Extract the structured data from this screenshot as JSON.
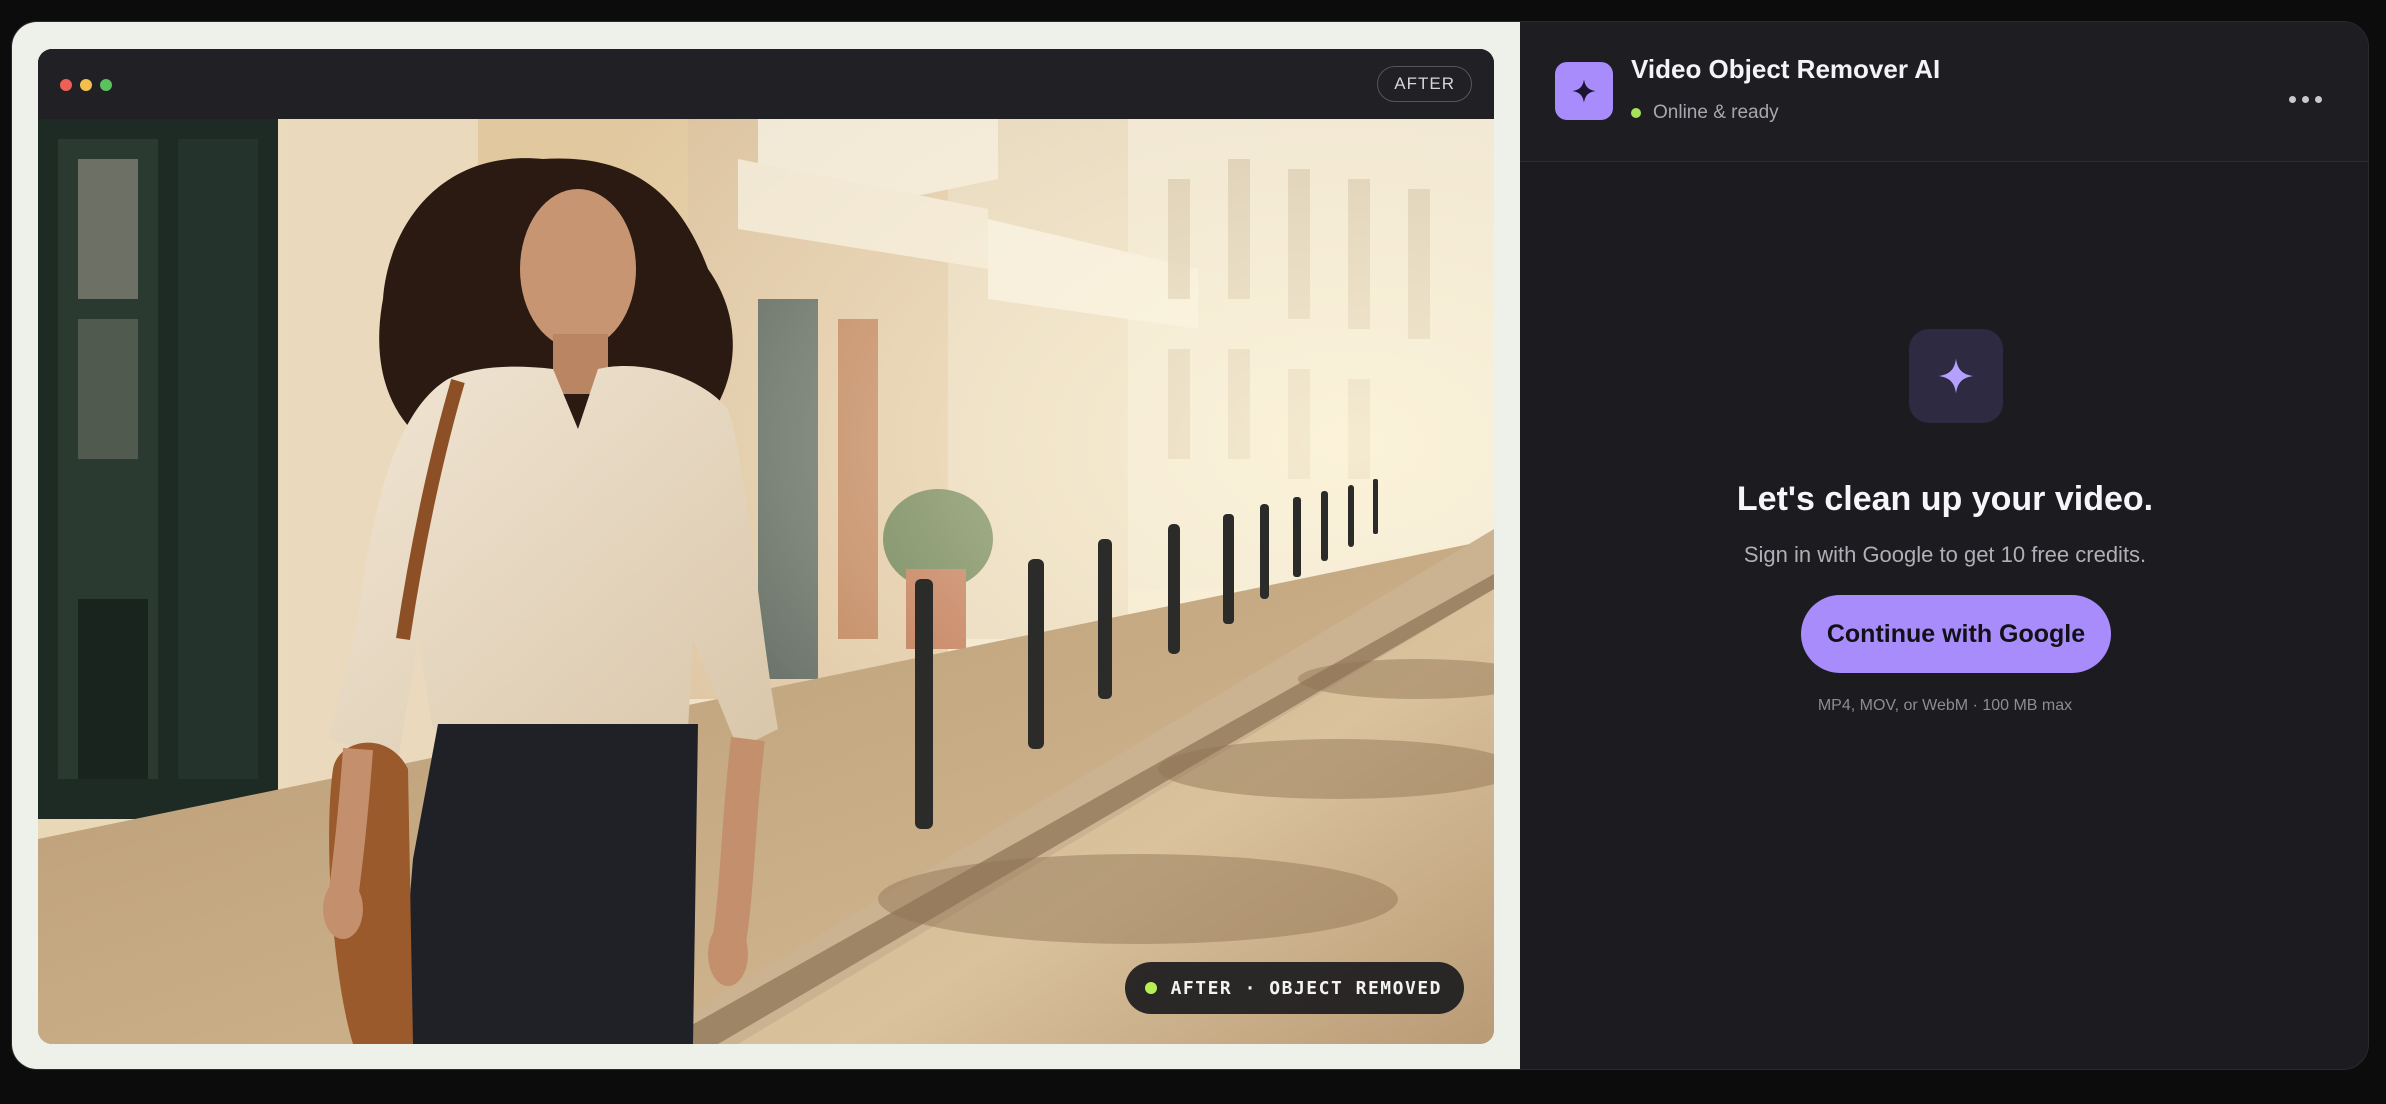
{
  "preview": {
    "window_badge": "AFTER",
    "status_chip": "AFTER · OBJECT REMOVED"
  },
  "panel": {
    "app_title": "Video Object Remover AI",
    "status": "Online & ready",
    "headline": "Let's clean up your video.",
    "subtitle": "Sign in with Google to get 10 free credits.",
    "cta_label": "Continue with Google",
    "format_note": "MP4, MOV, or WebM · 100 MB max"
  },
  "icons": {
    "app": "sparkle-icon",
    "hero": "sparkle-icon",
    "menu": "more-icon"
  },
  "colors": {
    "accent": "#a98cfc",
    "online": "#a6e35a",
    "chip_dot": "#b6f055"
  }
}
